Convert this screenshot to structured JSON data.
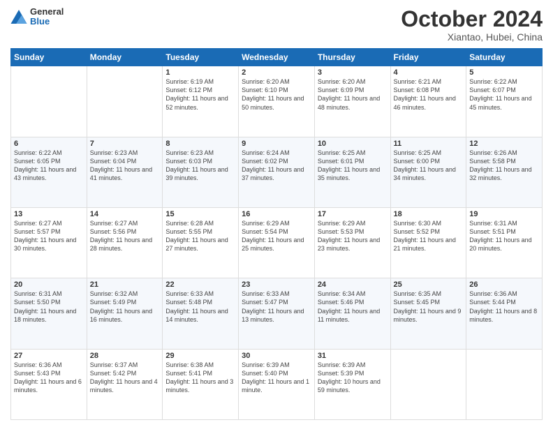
{
  "logo": {
    "line1": "General",
    "line2": "Blue"
  },
  "title": "October 2024",
  "subtitle": "Xiantao, Hubei, China",
  "days_header": [
    "Sunday",
    "Monday",
    "Tuesday",
    "Wednesday",
    "Thursday",
    "Friday",
    "Saturday"
  ],
  "weeks": [
    [
      {
        "num": "",
        "info": ""
      },
      {
        "num": "",
        "info": ""
      },
      {
        "num": "1",
        "info": "Sunrise: 6:19 AM\nSunset: 6:12 PM\nDaylight: 11 hours and 52 minutes."
      },
      {
        "num": "2",
        "info": "Sunrise: 6:20 AM\nSunset: 6:10 PM\nDaylight: 11 hours and 50 minutes."
      },
      {
        "num": "3",
        "info": "Sunrise: 6:20 AM\nSunset: 6:09 PM\nDaylight: 11 hours and 48 minutes."
      },
      {
        "num": "4",
        "info": "Sunrise: 6:21 AM\nSunset: 6:08 PM\nDaylight: 11 hours and 46 minutes."
      },
      {
        "num": "5",
        "info": "Sunrise: 6:22 AM\nSunset: 6:07 PM\nDaylight: 11 hours and 45 minutes."
      }
    ],
    [
      {
        "num": "6",
        "info": "Sunrise: 6:22 AM\nSunset: 6:05 PM\nDaylight: 11 hours and 43 minutes."
      },
      {
        "num": "7",
        "info": "Sunrise: 6:23 AM\nSunset: 6:04 PM\nDaylight: 11 hours and 41 minutes."
      },
      {
        "num": "8",
        "info": "Sunrise: 6:23 AM\nSunset: 6:03 PM\nDaylight: 11 hours and 39 minutes."
      },
      {
        "num": "9",
        "info": "Sunrise: 6:24 AM\nSunset: 6:02 PM\nDaylight: 11 hours and 37 minutes."
      },
      {
        "num": "10",
        "info": "Sunrise: 6:25 AM\nSunset: 6:01 PM\nDaylight: 11 hours and 35 minutes."
      },
      {
        "num": "11",
        "info": "Sunrise: 6:25 AM\nSunset: 6:00 PM\nDaylight: 11 hours and 34 minutes."
      },
      {
        "num": "12",
        "info": "Sunrise: 6:26 AM\nSunset: 5:58 PM\nDaylight: 11 hours and 32 minutes."
      }
    ],
    [
      {
        "num": "13",
        "info": "Sunrise: 6:27 AM\nSunset: 5:57 PM\nDaylight: 11 hours and 30 minutes."
      },
      {
        "num": "14",
        "info": "Sunrise: 6:27 AM\nSunset: 5:56 PM\nDaylight: 11 hours and 28 minutes."
      },
      {
        "num": "15",
        "info": "Sunrise: 6:28 AM\nSunset: 5:55 PM\nDaylight: 11 hours and 27 minutes."
      },
      {
        "num": "16",
        "info": "Sunrise: 6:29 AM\nSunset: 5:54 PM\nDaylight: 11 hours and 25 minutes."
      },
      {
        "num": "17",
        "info": "Sunrise: 6:29 AM\nSunset: 5:53 PM\nDaylight: 11 hours and 23 minutes."
      },
      {
        "num": "18",
        "info": "Sunrise: 6:30 AM\nSunset: 5:52 PM\nDaylight: 11 hours and 21 minutes."
      },
      {
        "num": "19",
        "info": "Sunrise: 6:31 AM\nSunset: 5:51 PM\nDaylight: 11 hours and 20 minutes."
      }
    ],
    [
      {
        "num": "20",
        "info": "Sunrise: 6:31 AM\nSunset: 5:50 PM\nDaylight: 11 hours and 18 minutes."
      },
      {
        "num": "21",
        "info": "Sunrise: 6:32 AM\nSunset: 5:49 PM\nDaylight: 11 hours and 16 minutes."
      },
      {
        "num": "22",
        "info": "Sunrise: 6:33 AM\nSunset: 5:48 PM\nDaylight: 11 hours and 14 minutes."
      },
      {
        "num": "23",
        "info": "Sunrise: 6:33 AM\nSunset: 5:47 PM\nDaylight: 11 hours and 13 minutes."
      },
      {
        "num": "24",
        "info": "Sunrise: 6:34 AM\nSunset: 5:46 PM\nDaylight: 11 hours and 11 minutes."
      },
      {
        "num": "25",
        "info": "Sunrise: 6:35 AM\nSunset: 5:45 PM\nDaylight: 11 hours and 9 minutes."
      },
      {
        "num": "26",
        "info": "Sunrise: 6:36 AM\nSunset: 5:44 PM\nDaylight: 11 hours and 8 minutes."
      }
    ],
    [
      {
        "num": "27",
        "info": "Sunrise: 6:36 AM\nSunset: 5:43 PM\nDaylight: 11 hours and 6 minutes."
      },
      {
        "num": "28",
        "info": "Sunrise: 6:37 AM\nSunset: 5:42 PM\nDaylight: 11 hours and 4 minutes."
      },
      {
        "num": "29",
        "info": "Sunrise: 6:38 AM\nSunset: 5:41 PM\nDaylight: 11 hours and 3 minutes."
      },
      {
        "num": "30",
        "info": "Sunrise: 6:39 AM\nSunset: 5:40 PM\nDaylight: 11 hours and 1 minute."
      },
      {
        "num": "31",
        "info": "Sunrise: 6:39 AM\nSunset: 5:39 PM\nDaylight: 10 hours and 59 minutes."
      },
      {
        "num": "",
        "info": ""
      },
      {
        "num": "",
        "info": ""
      }
    ]
  ]
}
